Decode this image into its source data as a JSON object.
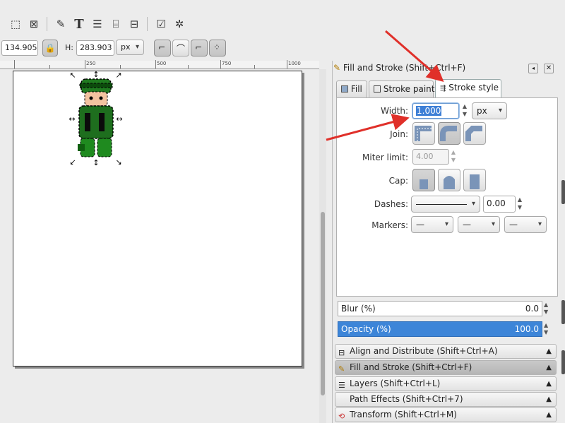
{
  "toolbar": {
    "x_value": "134.905",
    "h_label": "H:",
    "h_value": "283.903",
    "unit": "px"
  },
  "ruler": {
    "labels": [
      "250",
      "500",
      "750",
      "1000"
    ]
  },
  "panel": {
    "title": "Fill and Stroke (Shift+Ctrl+F)",
    "tabs": [
      "Fill",
      "Stroke paint",
      "Stroke style"
    ],
    "width_label": "Width:",
    "width_value": "1.000",
    "width_unit": "px",
    "join_label": "Join:",
    "miter_label": "Miter limit:",
    "miter_value": "4.00",
    "cap_label": "Cap:",
    "dashes_label": "Dashes:",
    "dashes_offset": "0.00",
    "markers_label": "Markers:",
    "marker_value": "—",
    "blur_label": "Blur (%)",
    "blur_value": "0.0",
    "opacity_label": "Opacity (%)",
    "opacity_value": "100.0",
    "opacity_color": "#3d85d8"
  },
  "docked": [
    "Align and Distribute (Shift+Ctrl+A)",
    "Fill and Stroke (Shift+Ctrl+F)",
    "Layers (Shift+Ctrl+L)",
    "Path Effects (Shift+Ctrl+7)",
    "Transform (Shift+Ctrl+M)"
  ],
  "accent": "#e0302a"
}
